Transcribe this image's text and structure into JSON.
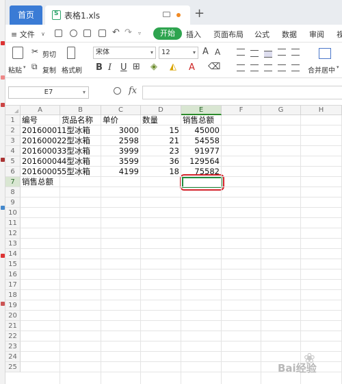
{
  "titlebar": {
    "home_tab": "首页",
    "doc_tab": "表格1.xls",
    "new_tab": "+"
  },
  "menu": {
    "file": "≡ 文件",
    "start": "开始",
    "items": [
      "插入",
      "页面布局",
      "公式",
      "数据",
      "审阅",
      "视"
    ]
  },
  "toolbar": {
    "paste": "粘贴",
    "cut": "剪切",
    "copy": "复制",
    "format_painter": "格式刷",
    "font_name": "宋体",
    "font_size": "12",
    "merge_center": "合并居中"
  },
  "formula_bar": {
    "cell_ref": "E7",
    "fx": "fx",
    "value": ""
  },
  "sheet": {
    "columns": [
      "A",
      "B",
      "C",
      "D",
      "E",
      "F",
      "G",
      "H"
    ],
    "rows": [
      [
        "编号",
        "货品名称",
        "单价",
        "数量",
        "销售总额"
      ],
      [
        "20160001",
        "1型冰箱",
        "3000",
        "15",
        "45000"
      ],
      [
        "20160002",
        "2型冰箱",
        "2598",
        "21",
        "54558"
      ],
      [
        "20160003",
        "3型冰箱",
        "3999",
        "23",
        "91977"
      ],
      [
        "20160004",
        "4型冰箱",
        "3599",
        "36",
        "129564"
      ],
      [
        "20160005",
        "5型冰箱",
        "4199",
        "18",
        "75582"
      ],
      [
        "销售总额",
        "",
        "",
        "",
        ""
      ]
    ],
    "row_numbers": [
      "1",
      "2",
      "3",
      "4",
      "5",
      "6",
      "7",
      "8",
      "9",
      "10",
      "11",
      "12",
      "13",
      "14",
      "15",
      "16",
      "17",
      "18",
      "19",
      "20",
      "21",
      "22",
      "23",
      "24",
      "25"
    ],
    "active_cell": "E7"
  },
  "watermark": "Bai经验"
}
